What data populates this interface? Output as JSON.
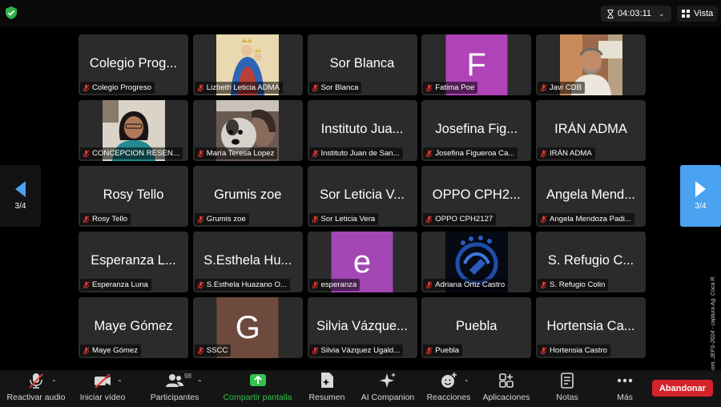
{
  "topbar": {
    "timer": "04:03:11",
    "view_label": "Vista"
  },
  "pagination": {
    "left_label": "3/4",
    "right_label": "3/4"
  },
  "watermark": "Cortesía © Zoom. JEFS-2024 - captura Ag. Coca R.",
  "participants": [
    {
      "tile": "Colegio Prog...",
      "name": "Colegio Progreso"
    },
    {
      "tile": "",
      "name": "Lizbeth Leticia ADMA",
      "photo": "madonna"
    },
    {
      "tile": "Sor Blanca",
      "name": "Sor Blanca"
    },
    {
      "tile": "",
      "name": "Fatima Poe",
      "avatar": "F",
      "avatar_color": "#b043b8"
    },
    {
      "tile": "",
      "name": "Javi CDB",
      "photo": "man"
    },
    {
      "tile": "",
      "name": "CONCEPCION RESEN...",
      "photo": "woman"
    },
    {
      "tile": "",
      "name": "María Teresa Lopez",
      "photo": "dog"
    },
    {
      "tile": "Instituto Jua...",
      "name": "Instituto Juan de San..."
    },
    {
      "tile": "Josefina Fig...",
      "name": "Josefina Figueroa Ca..."
    },
    {
      "tile": "IRÁN ADMA",
      "name": "IRÁN ADMA"
    },
    {
      "tile": "Rosy Tello",
      "name": "Rosy Tello"
    },
    {
      "tile": "Grumis zoe",
      "name": "Grumis zoe"
    },
    {
      "tile": "Sor Leticia V...",
      "name": "Sor Leticia Vera"
    },
    {
      "tile": "OPPO CPH2...",
      "name": "OPPO CPH2127"
    },
    {
      "tile": "Angela Mend...",
      "name": "Angela Mendoza Padi..."
    },
    {
      "tile": "Esperanza L...",
      "name": "Esperanza Luna"
    },
    {
      "tile": "S.Esthela Hu...",
      "name": "S.Esthela Huazano O..."
    },
    {
      "tile": "",
      "name": "esperanza",
      "avatar": "e",
      "avatar_color": "#a347b5"
    },
    {
      "tile": "",
      "name": "Adriana Ortiz Castro",
      "photo": "logo"
    },
    {
      "tile": "S. Refugio C...",
      "name": "S. Refugio Colin"
    },
    {
      "tile": "Maye Gómez",
      "name": "Maye Gómez"
    },
    {
      "tile": "",
      "name": "SSCC",
      "avatar": "G",
      "avatar_color": "#6e4a3e"
    },
    {
      "tile": "Silvia Vázque...",
      "name": "Silvia Vázquez Ugald..."
    },
    {
      "tile": "Puebla",
      "name": "Puebla"
    },
    {
      "tile": "Hortensia Ca...",
      "name": "Hortensia Castro"
    }
  ],
  "toolbar": {
    "unmute": "Reactivar audio",
    "video": "Iniciar vídeo",
    "participants": "Participantes",
    "participants_count": "98",
    "share": "Compartir pantalla",
    "summary": "Resumen",
    "ai": "AI Companion",
    "reactions": "Reacciones",
    "apps": "Aplicaciones",
    "notes": "Notas",
    "more": "Más",
    "leave": "Abandonar"
  },
  "colors": {
    "accent_blue": "#4aa3f0",
    "share_green": "#33c24d",
    "leave_red": "#d4232b",
    "mute_red": "#e0352f",
    "shield_green": "#2fb24c"
  }
}
